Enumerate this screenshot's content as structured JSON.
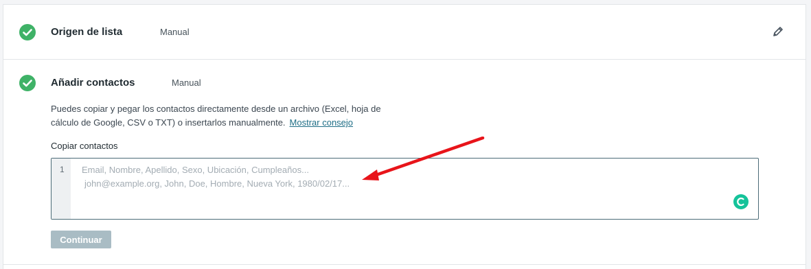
{
  "steps": [
    {
      "title": "Origen de lista",
      "value": "Manual"
    },
    {
      "title": "Añadir contactos",
      "value": "Manual"
    }
  ],
  "add_contacts": {
    "description": "Puedes copiar y pegar los contactos directamente desde un archivo (Excel, hoja de cálculo de Google, CSV o TXT) o insertarlos manualmente.",
    "tip_link": "Mostrar consejo",
    "field_label": "Copiar contactos",
    "line_number": "1",
    "placeholder_line1": "Email, Nombre, Apellido, Sexo, Ubicación, Cumpleaños...",
    "placeholder_line2": "john@example.org, John, Doe, Hombre, Nueva York, 1980/02/17...",
    "continue_label": "Continuar"
  },
  "colors": {
    "check": "#3fb267",
    "annotation_arrow": "#e8141a",
    "button_disabled": "#a9bcc4",
    "grammarly": "#15c39a"
  }
}
